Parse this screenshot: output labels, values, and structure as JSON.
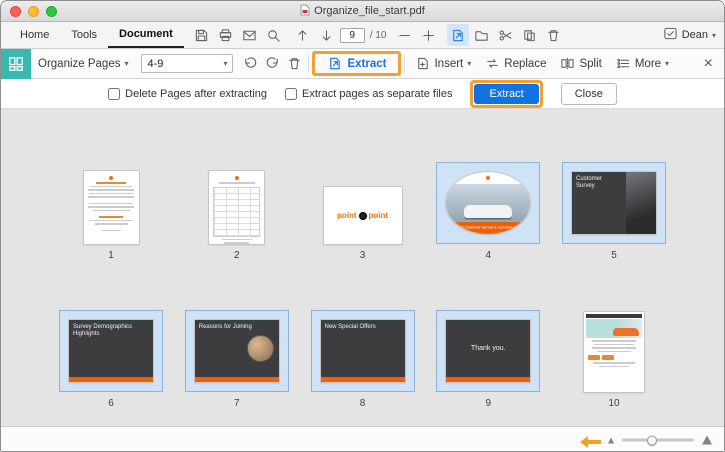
{
  "window_chrome": {
    "title": "Organize_file_start.pdf"
  },
  "tabs": {
    "home": "Home",
    "tools": "Tools",
    "document": "Document"
  },
  "page_nav": {
    "current": "9",
    "total": "/ 10"
  },
  "account": {
    "name": "Dean"
  },
  "organize_bar": {
    "tool_name": "Organize Pages",
    "page_range": "4-9",
    "extract": "Extract",
    "insert": "Insert",
    "replace": "Replace",
    "split": "Split",
    "more": "More"
  },
  "options_bar": {
    "delete_after": "Delete Pages after extracting",
    "separate_files": "Extract pages as separate files",
    "extract_button": "Extract",
    "close_button": "Close"
  },
  "pages": [
    {
      "num": "1"
    },
    {
      "num": "2"
    },
    {
      "num": "3",
      "logo_left": "point",
      "logo_right": "point"
    },
    {
      "num": "4",
      "banner": "2015 Customer Survey & Incentive Plan"
    },
    {
      "num": "5",
      "title": "Customer Survey"
    },
    {
      "num": "6",
      "title": "Survey Demographics Highlights"
    },
    {
      "num": "7",
      "title": "Reasons for Joining"
    },
    {
      "num": "8",
      "title": "New Special Offers"
    },
    {
      "num": "9",
      "title": "Thank you."
    },
    {
      "num": "10"
    }
  ],
  "glyphs": {
    "chevron_down": "▾",
    "close_x": "×"
  },
  "colors": {
    "accent_blue": "#1473e6",
    "selection_fill": "#cfe2f6",
    "selection_border": "#85aed6",
    "teal": "#38b8ae",
    "highlight_orange": "#f2a132",
    "slide_orange": "#e8630c"
  }
}
